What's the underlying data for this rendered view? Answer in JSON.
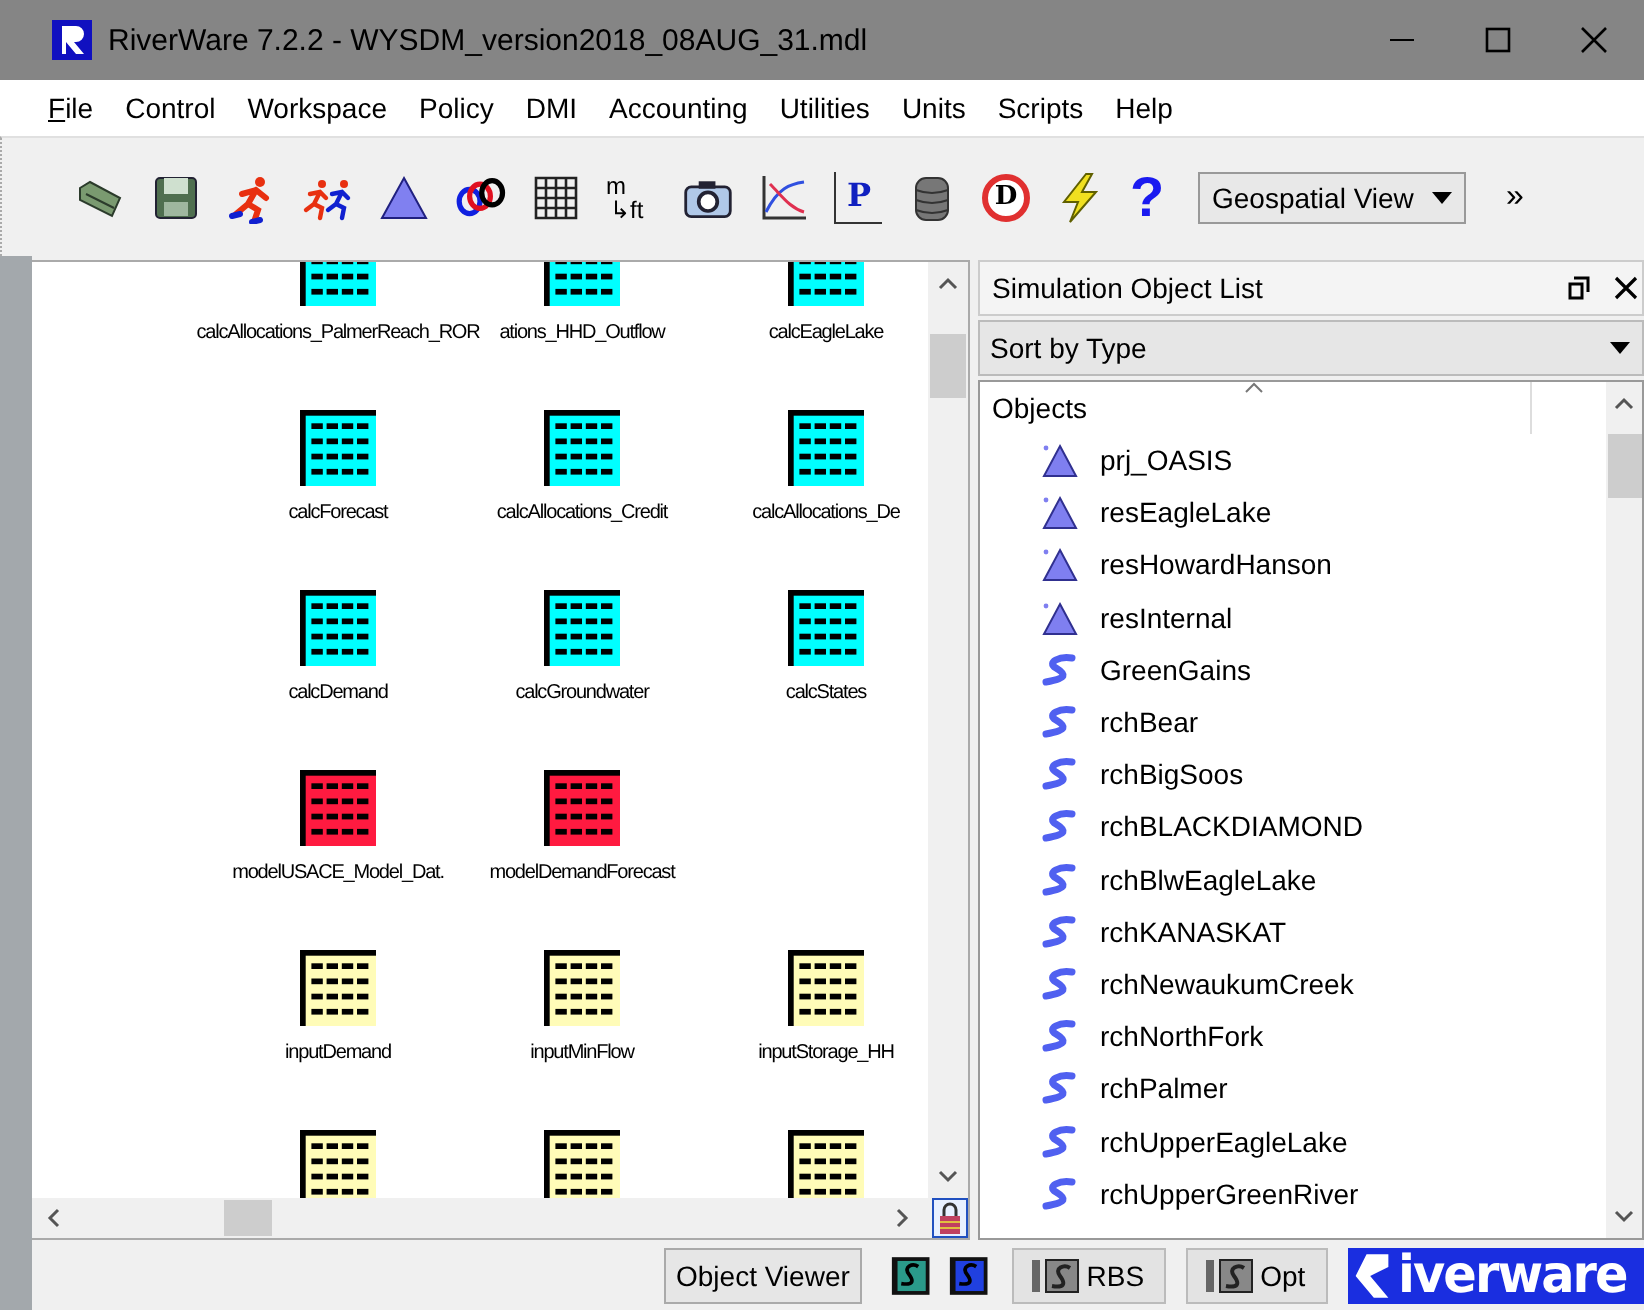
{
  "window": {
    "title": "RiverWare 7.2.2 - WYSDM_version2018_08AUG_31.mdl"
  },
  "menu": [
    {
      "label": "File",
      "mnemonic": true
    },
    {
      "label": "Control"
    },
    {
      "label": "Workspace"
    },
    {
      "label": "Policy"
    },
    {
      "label": "DMI"
    },
    {
      "label": "Accounting"
    },
    {
      "label": "Utilities"
    },
    {
      "label": "Units"
    },
    {
      "label": "Scripts"
    },
    {
      "label": "Help"
    }
  ],
  "toolbar": [
    {
      "kind": "folder"
    },
    {
      "kind": "save"
    },
    {
      "kind": "run"
    },
    {
      "kind": "run2"
    },
    {
      "kind": "triangle"
    },
    {
      "kind": "links"
    },
    {
      "kind": "grid"
    },
    {
      "kind": "units",
      "top": "m",
      "bottom": "↳ft"
    },
    {
      "kind": "camera"
    },
    {
      "kind": "plot"
    },
    {
      "kind": "pplot",
      "text": "P"
    },
    {
      "kind": "database"
    },
    {
      "kind": "stop",
      "text": "D"
    },
    {
      "kind": "lightning"
    },
    {
      "kind": "help",
      "text": "?"
    }
  ],
  "view_select": {
    "value": "Geospatial View"
  },
  "overflow": "»",
  "workspace": {
    "rows": [
      [
        {
          "label": "calcAllocations_PalmerReach_ROR",
          "color": "#00ffff"
        },
        {
          "label": "ations_HHD_Outflow",
          "color": "#00ffff"
        },
        {
          "label": "calcEagleLake",
          "color": "#00ffff"
        }
      ],
      [
        {
          "label": "calcForecast",
          "color": "#00ffff"
        },
        {
          "label": "calcAllocations_Credit",
          "color": "#00ffff"
        },
        {
          "label": "calcAllocations_De",
          "color": "#00ffff"
        }
      ],
      [
        {
          "label": "calcDemand",
          "color": "#00ffff"
        },
        {
          "label": "calcGroundwater",
          "color": "#00ffff"
        },
        {
          "label": "calcStates",
          "color": "#00ffff"
        }
      ],
      [
        {
          "label": "modelUSACE_Model_Dat.",
          "color": "#ff1a40"
        },
        {
          "label": "modelDemandForecast",
          "color": "#ff1a40"
        }
      ],
      [
        {
          "label": "inputDemand",
          "color": "#fffcb8"
        },
        {
          "label": "inputMinFlow",
          "color": "#fffcb8"
        },
        {
          "label": "inputStorage_HH",
          "color": "#fffcb8"
        }
      ],
      [
        {
          "color": "#fffcb8"
        },
        {
          "color": "#fffcb8"
        },
        {
          "color": "#fffcb8"
        }
      ]
    ]
  },
  "object_list": {
    "title": "Simulation Object List",
    "sort": "Sort by Type",
    "header": "Objects",
    "items": [
      {
        "name": "prj_OASIS",
        "kind": "reservoir"
      },
      {
        "name": "resEagleLake",
        "kind": "reservoir"
      },
      {
        "name": "resHowardHanson",
        "kind": "reservoir"
      },
      {
        "name": "resInternal",
        "kind": "reservoir"
      },
      {
        "name": "GreenGains",
        "kind": "reach"
      },
      {
        "name": "rchBear",
        "kind": "reach"
      },
      {
        "name": "rchBigSoos",
        "kind": "reach"
      },
      {
        "name": "rchBLACKDIAMOND",
        "kind": "reach"
      },
      {
        "name": "rchBlwEagleLake",
        "kind": "reach"
      },
      {
        "name": "rchKANASKAT",
        "kind": "reach"
      },
      {
        "name": "rchNewaukumCreek",
        "kind": "reach"
      },
      {
        "name": "rchNorthFork",
        "kind": "reach"
      },
      {
        "name": "rchPalmer",
        "kind": "reach"
      },
      {
        "name": "rchUpperEagleLake",
        "kind": "reach"
      },
      {
        "name": "rchUpperGreenRiver",
        "kind": "reach"
      }
    ]
  },
  "status_bar": {
    "object_viewer": "Object Viewer",
    "rbs": "RBS",
    "opt": "Opt",
    "logo": "iverware"
  }
}
